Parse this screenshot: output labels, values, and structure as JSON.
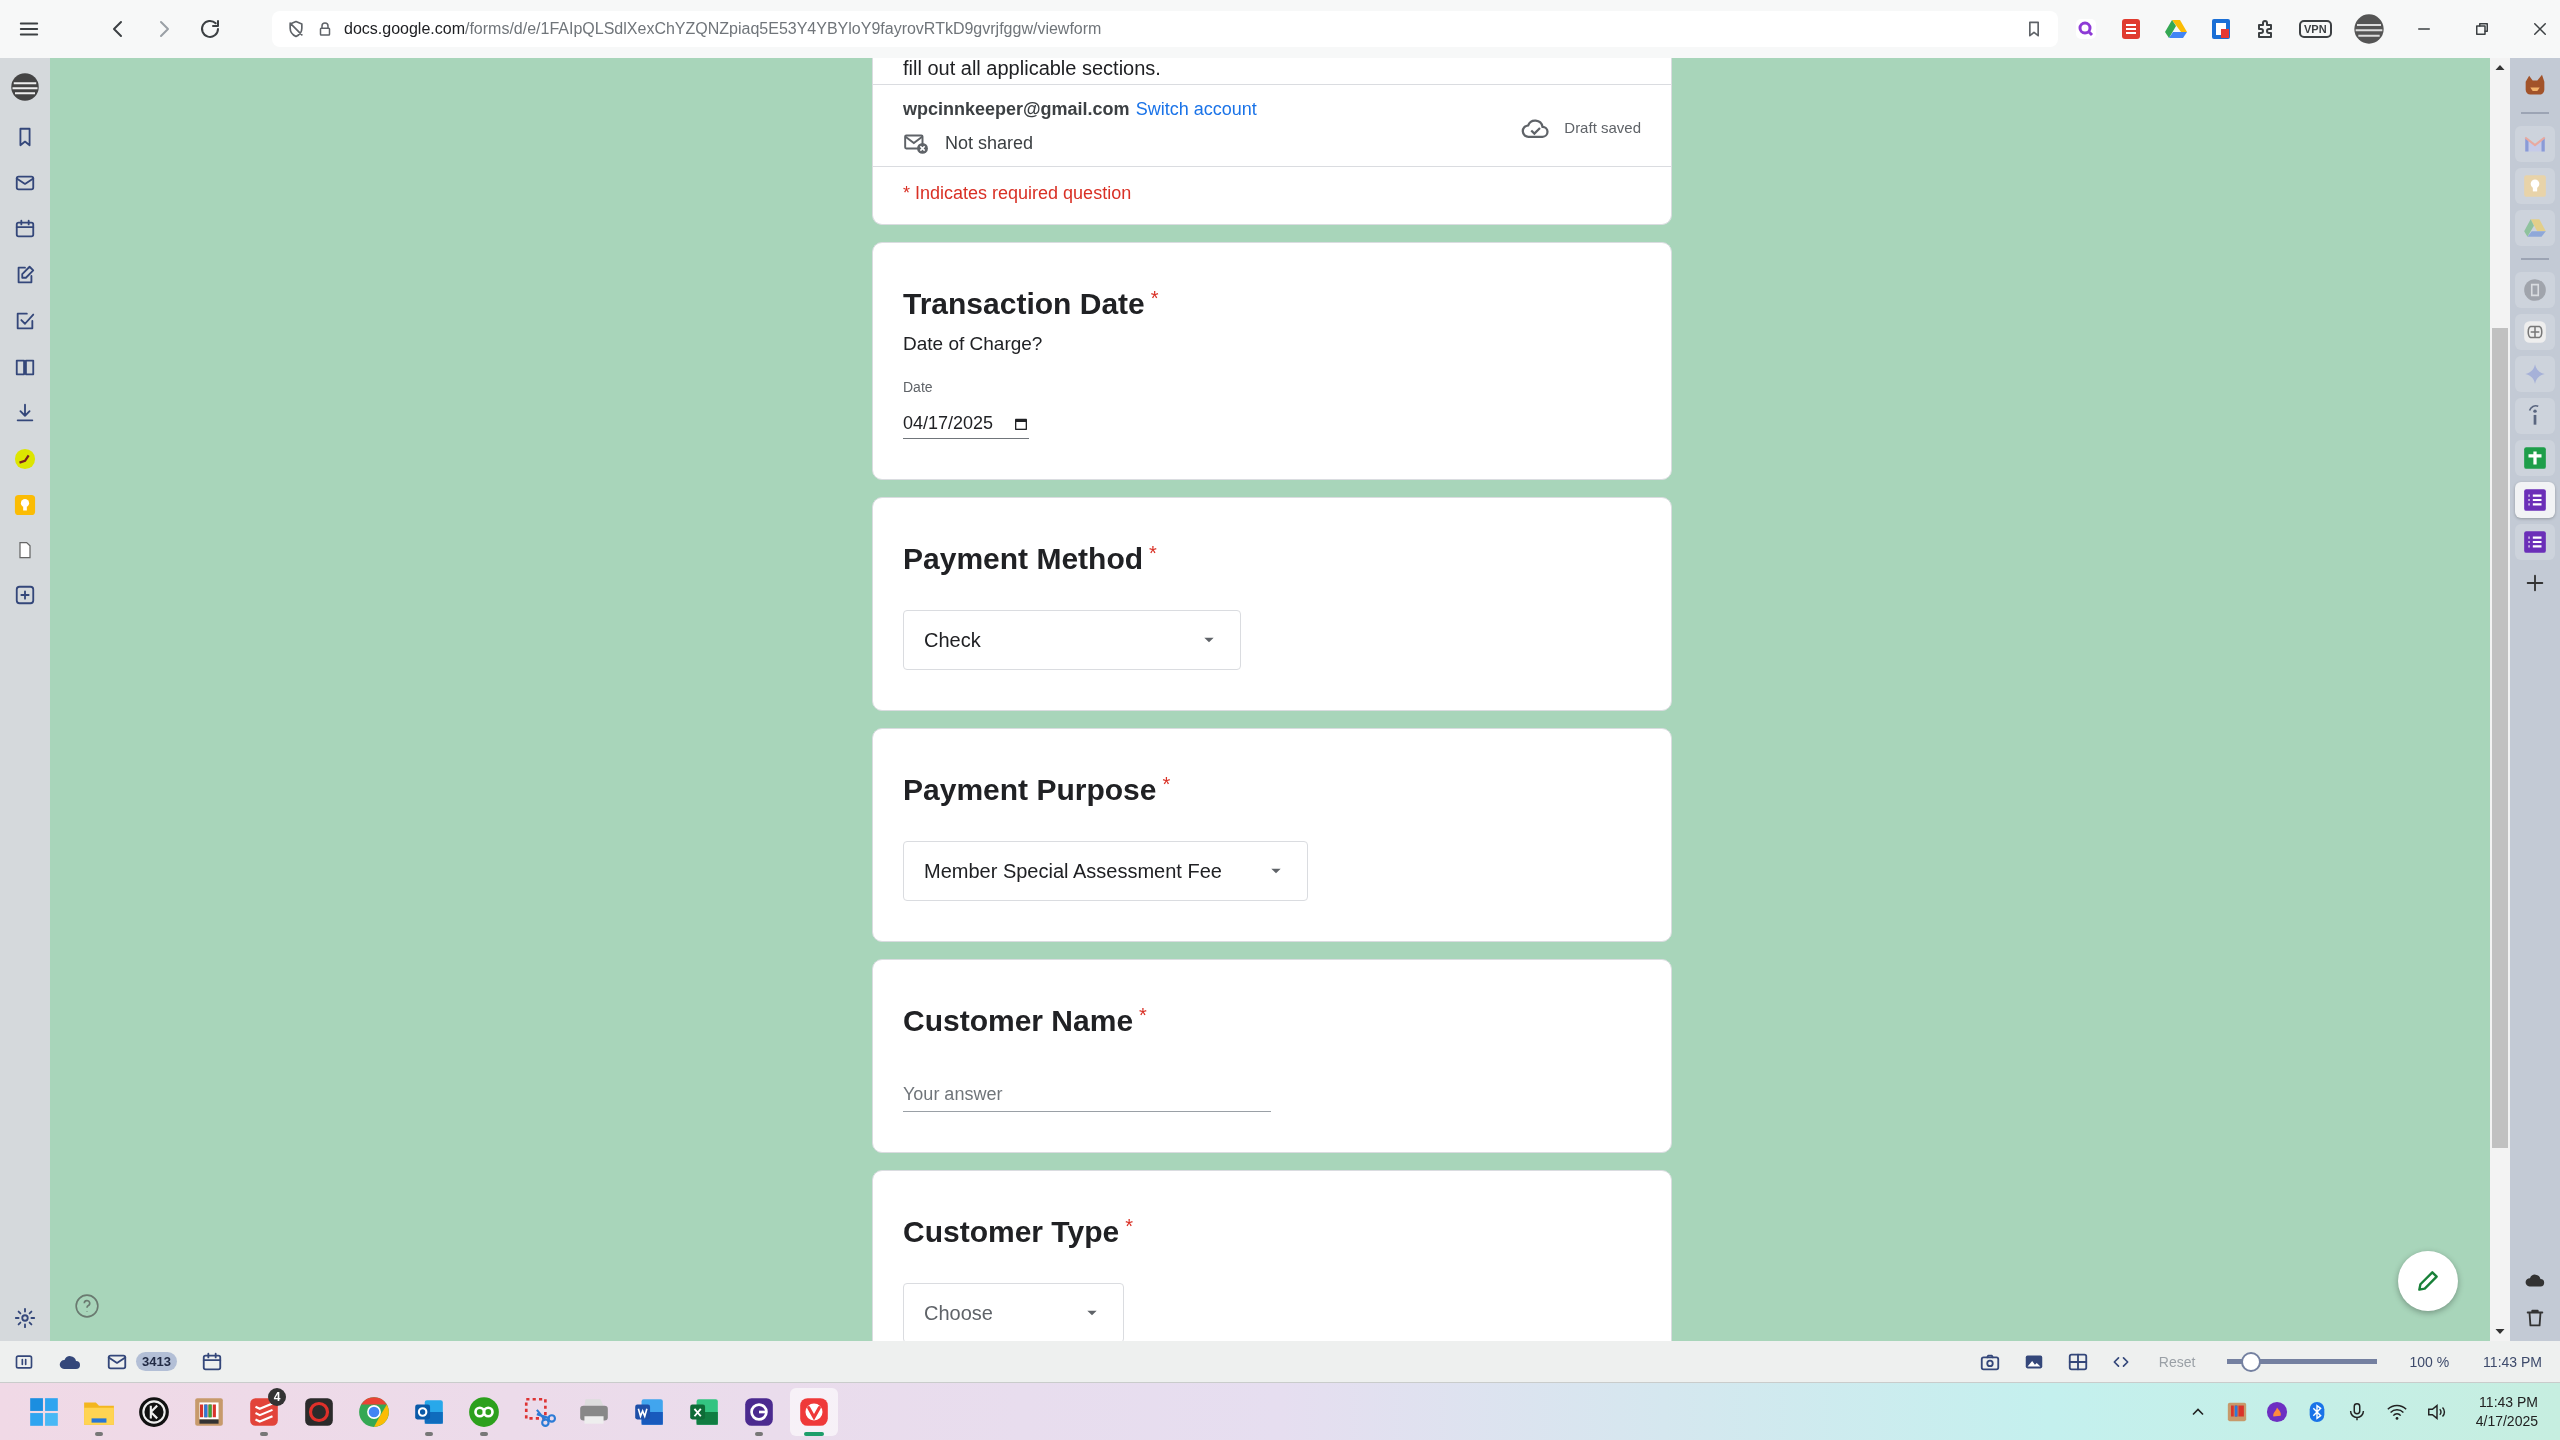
{
  "browser": {
    "url_host": "docs.google.com",
    "url_path": "/forms/d/e/1FAIpQLSdlXexChYZQNZpiaq5E53Y4YBYloY9fayrovRTkD9gvrjfggw/viewform",
    "vpn_label": "VPN"
  },
  "form": {
    "intro_tail": "fill out all applicable sections.",
    "account": "wpcinnkeeper@gmail.com",
    "switch_link": "Switch account",
    "sharing": "Not shared",
    "draft_status": "Draft saved",
    "required_note": "* Indicates required question",
    "questions": [
      {
        "kind": "date",
        "title": "Transaction Date",
        "required_mark": "*",
        "description": "Date of Charge?",
        "field_label": "Date",
        "value": "04/17/2025"
      },
      {
        "kind": "dropdown",
        "title": "Payment Method",
        "required_mark": "*",
        "value": "Check"
      },
      {
        "kind": "dropdown",
        "title": "Payment Purpose",
        "required_mark": "*",
        "value": "Member Special Assessment Fee"
      },
      {
        "kind": "text",
        "title": "Customer Name",
        "required_mark": "*",
        "placeholder": "Your answer"
      },
      {
        "kind": "dropdown",
        "title": "Customer Type",
        "required_mark": "*",
        "placeholder": "Choose"
      }
    ]
  },
  "status_bar": {
    "mail_count": "3413",
    "reset": "Reset",
    "zoom": {
      "level": 0.2,
      "reading": "100 %"
    },
    "clock": "11:43 PM"
  },
  "taskbar": {
    "apps": [
      {
        "kind": "start",
        "running": false,
        "selected": false
      },
      {
        "kind": "folder",
        "running": true,
        "selected": false
      },
      {
        "kind": "k-circle",
        "running": false,
        "selected": false
      },
      {
        "kind": "palette",
        "running": false,
        "selected": false
      },
      {
        "kind": "todo",
        "running": true,
        "selected": false,
        "badge": "4"
      },
      {
        "kind": "s-app",
        "running": false,
        "selected": false
      },
      {
        "kind": "chrome",
        "running": false,
        "selected": false
      },
      {
        "kind": "outlook",
        "running": true,
        "selected": false
      },
      {
        "kind": "quickbooks",
        "running": true,
        "selected": false
      },
      {
        "kind": "snip",
        "running": false,
        "selected": false
      },
      {
        "kind": "fax",
        "running": false,
        "selected": false
      },
      {
        "kind": "word",
        "running": false,
        "selected": false
      },
      {
        "kind": "excel",
        "running": false,
        "selected": false
      },
      {
        "kind": "g-app",
        "running": true,
        "selected": false
      },
      {
        "kind": "vivaldi",
        "running": true,
        "selected": true
      }
    ],
    "clock_time": "11:43 PM",
    "clock_date": "4/17/2025"
  }
}
